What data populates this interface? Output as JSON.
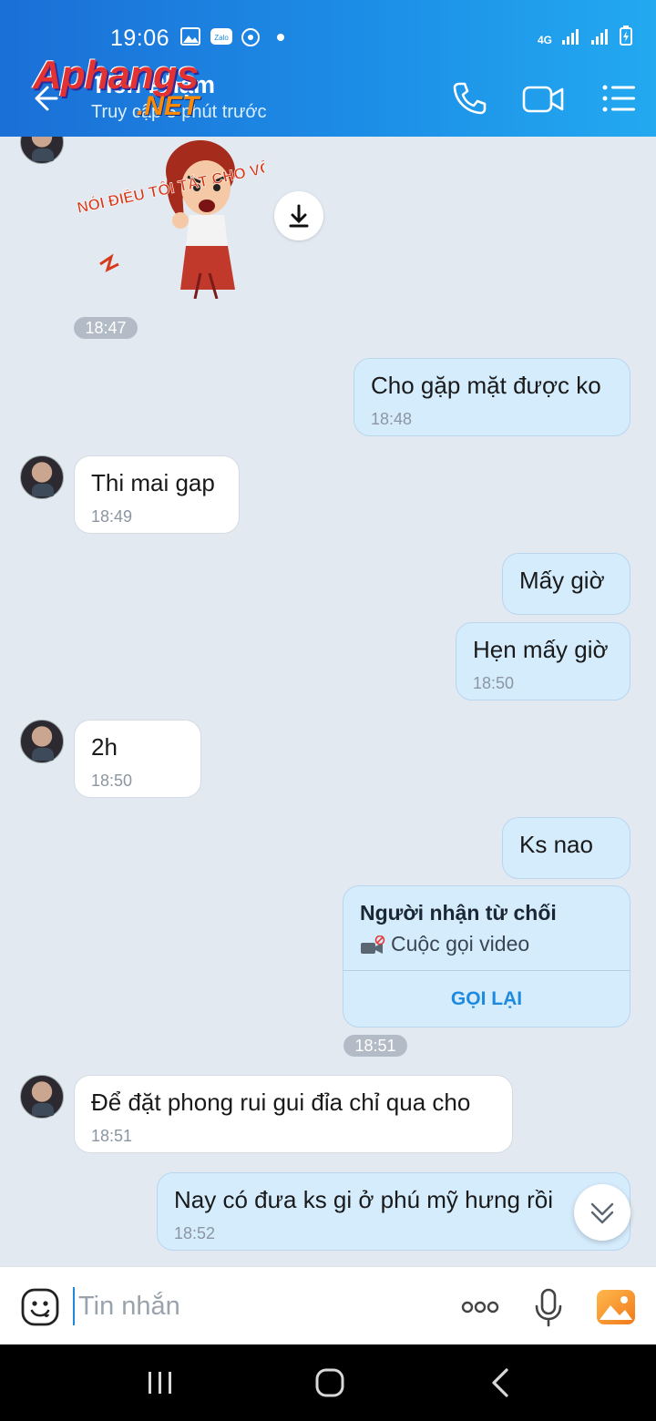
{
  "status_bar": {
    "time": "19:06",
    "network": "4G"
  },
  "header": {
    "contact_name": "Tiến Phạm",
    "contact_status": "Truy cập 5 phút trước",
    "watermark_main": "Aphangs",
    "watermark_sub": ".NET"
  },
  "chat": {
    "sticker": {
      "alt_text": "NÓI ĐIỀU TÔI TÁT CHO VỠ MỒM",
      "time": "18:47"
    },
    "messages": [
      {
        "side": "out",
        "text": "Cho gặp mặt được ko",
        "time": "18:48"
      },
      {
        "side": "in",
        "text": "Thi mai gap",
        "time": "18:49"
      },
      {
        "side": "out",
        "text": "Mấy giờ",
        "time": ""
      },
      {
        "side": "out",
        "text": "Hẹn mấy giờ",
        "time": "18:50"
      },
      {
        "side": "in",
        "text": "2h",
        "time": "18:50"
      },
      {
        "side": "out",
        "text": "Ks nao",
        "time": ""
      },
      {
        "side": "in",
        "text": "Để đặt phong rui gui đỉa chỉ qua cho",
        "time": "18:51"
      },
      {
        "side": "out",
        "text": "Nay có đưa ks gi ở phú mỹ hưng rồi",
        "time": "18:52"
      }
    ],
    "call_card": {
      "title": "Người nhận từ chối",
      "subtitle": "Cuộc gọi video",
      "action": "GỌI LẠI",
      "time": "18:51"
    }
  },
  "input_bar": {
    "placeholder": "Tin nhắn"
  },
  "icons": {
    "back": "arrow-left-icon",
    "call": "phone-icon",
    "video": "video-camera-icon",
    "menu": "list-menu-icon",
    "download": "download-icon",
    "emoji": "emoji-icon",
    "more": "more-dots-icon",
    "mic": "microphone-icon",
    "image": "image-icon",
    "scroll_down": "chevron-double-down-icon"
  },
  "colors": {
    "header_start": "#1b6fd6",
    "header_end": "#23a9f0",
    "bubble_out": "#d5ecfd",
    "bubble_in": "#ffffff",
    "accent": "#1d8ae0"
  }
}
